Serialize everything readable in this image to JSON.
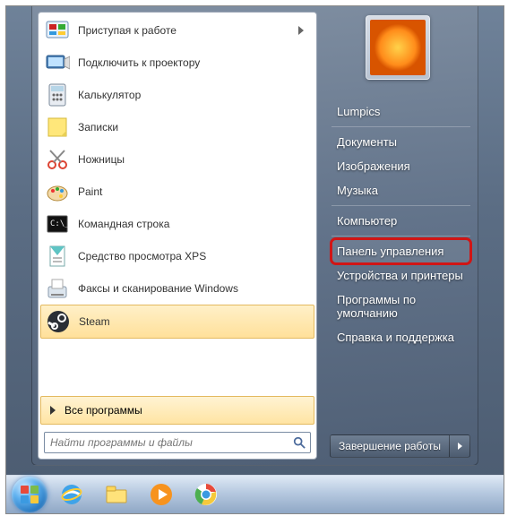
{
  "programs": [
    {
      "label": "Приступая к работе",
      "icon": "getting-started",
      "has_submenu": true
    },
    {
      "label": "Подключить к проектору",
      "icon": "projector",
      "has_submenu": false
    },
    {
      "label": "Калькулятор",
      "icon": "calculator",
      "has_submenu": false
    },
    {
      "label": "Записки",
      "icon": "sticky-notes",
      "has_submenu": false
    },
    {
      "label": "Ножницы",
      "icon": "snipping",
      "has_submenu": false
    },
    {
      "label": "Paint",
      "icon": "paint",
      "has_submenu": false
    },
    {
      "label": "Командная строка",
      "icon": "cmd",
      "has_submenu": false
    },
    {
      "label": "Средство просмотра XPS",
      "icon": "xps",
      "has_submenu": false
    },
    {
      "label": "Факсы и сканирование Windows",
      "icon": "fax",
      "has_submenu": false
    },
    {
      "label": "Steam",
      "icon": "steam",
      "has_submenu": false,
      "highlight": true
    }
  ],
  "all_programs": "Все программы",
  "search": {
    "placeholder": "Найти программы и файлы"
  },
  "right_links": [
    {
      "label": "Lumpics",
      "sep_after": true
    },
    {
      "label": "Документы"
    },
    {
      "label": "Изображения"
    },
    {
      "label": "Музыка",
      "sep_after": true
    },
    {
      "label": "Компьютер",
      "sep_after": true
    },
    {
      "label": "Панель управления",
      "highlighted": true
    },
    {
      "label": "Устройства и принтеры"
    },
    {
      "label": "Программы по умолчанию"
    },
    {
      "label": "Справка и поддержка"
    }
  ],
  "shutdown": {
    "label": "Завершение работы"
  },
  "taskbar_icons": [
    "ie",
    "explorer",
    "media-player",
    "chrome"
  ]
}
